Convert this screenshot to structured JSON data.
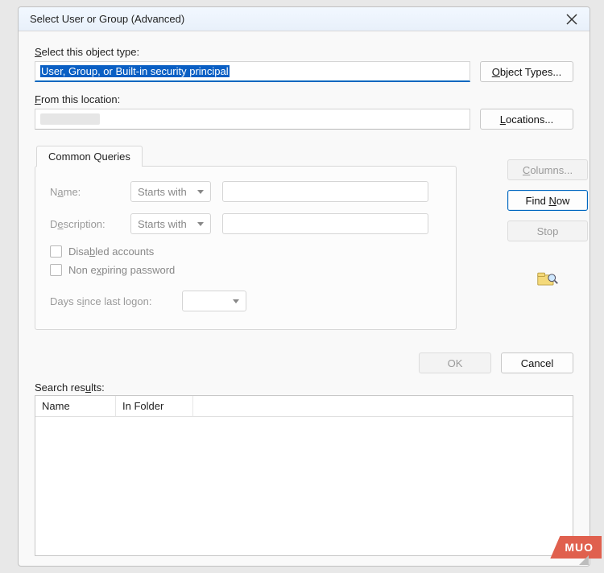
{
  "window": {
    "title": "Select User or Group (Advanced)"
  },
  "labels": {
    "objectType": "elect this object type:",
    "objectTypePrefix": "S",
    "location": "rom this location:",
    "locationPrefix": "F",
    "searchResults": "Search res",
    "searchResultsU": "u",
    "searchResultsEnd": "lts:"
  },
  "fields": {
    "objectTypeValue": "User, Group, or Built-in security principal",
    "locationValue": ""
  },
  "buttons": {
    "objectTypesPrefix": "O",
    "objectTypes": "bject Types...",
    "locationsPrefix": "L",
    "locations": "ocations...",
    "columnsPrefix": "C",
    "columns": "olumns...",
    "findNow": "Find ",
    "findNowN": "N",
    "findNowEnd": "ow",
    "stop": "Stop",
    "ok": "OK",
    "cancel": "Cancel"
  },
  "tab": {
    "commonQueries": "Common Queries"
  },
  "queries": {
    "nameLabel": "N",
    "nameLabelU": "a",
    "nameLabelEnd": "me:",
    "nameMatch": "Starts with",
    "descLabel": "D",
    "descLabelU": "e",
    "descLabelEnd": "scription:",
    "descMatch": "Starts with",
    "disabledAccounts": "Disa",
    "disabledAccountsU": "b",
    "disabledAccountsEnd": "led accounts",
    "nonExpiring": "Non e",
    "nonExpiringU": "x",
    "nonExpiringEnd": "piring password",
    "daysSince": "Days s",
    "daysSinceU": "i",
    "daysSinceEnd": "nce last logon:"
  },
  "columns": {
    "name": "Name",
    "inFolder": "In Folder"
  },
  "watermark": "MUO"
}
